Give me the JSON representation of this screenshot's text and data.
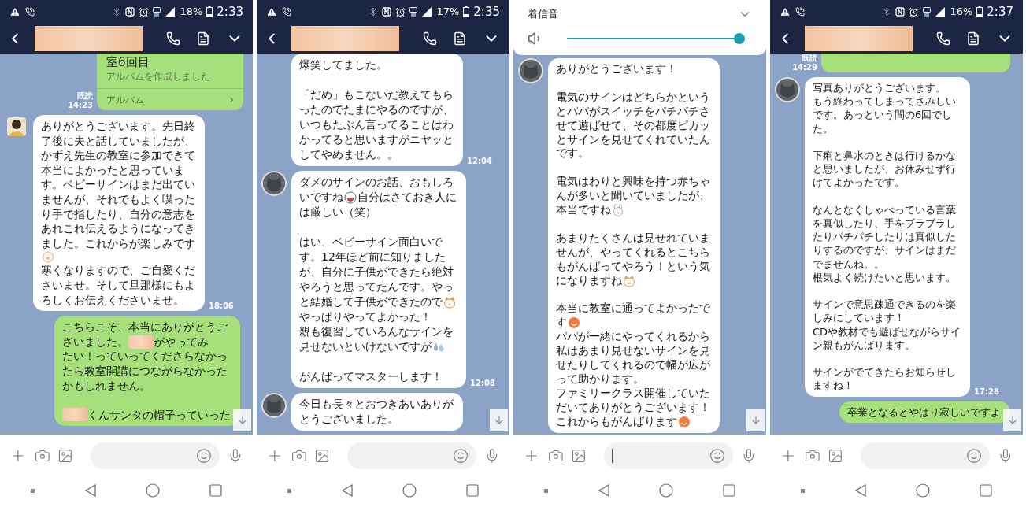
{
  "panels": [
    {
      "kind": "chat",
      "status_bar": {
        "battery": "18%",
        "time": "2:33"
      },
      "input": {
        "focused": false
      },
      "messages": [
        {
          "kind": "album",
          "outgoing": true,
          "title": "室6回目",
          "subtitle": "アルバムを作成しました",
          "link": "アルバム",
          "link_arrow": "›",
          "read": "既読",
          "time": "14:23"
        },
        {
          "kind": "text",
          "outgoing": false,
          "avatar": {
            "kind": "person"
          },
          "time": "18:06",
          "paragraphs": [
            [
              "ありがとうございます。先日終",
              "了後に夫と話していましたが、",
              "かずえ先生の教室に参加できて",
              "本当によかったと思っていま",
              "す。ベビーサインはまだ出てい",
              "ませんが、それでもよく喋った",
              "り手で指したり、自分の意志を",
              "あれこれ伝えるようになってき",
              "ました。これからが楽しみです",
              {
                "parts": [
                  {
                    "kind": "pig"
                  }
                ]
              },
              "寒くなりますので、ご自愛くだ",
              "さいませ。そして旦那様にもよ",
              "ろしくお伝えくださいませ。"
            ]
          ]
        },
        {
          "kind": "text",
          "outgoing": true,
          "paragraphs": [
            [
              "こちらこそ、本当にありがとうご",
              {
                "parts": [
                  {
                    "kind": "text",
                    "text": "ざいました。"
                  },
                  {
                    "kind": "redacted"
                  },
                  {
                    "kind": "text",
                    "text": "がやってみ"
                  }
                ]
              },
              "たい！っていってくださらなかっ",
              "たら教室開講につながらなかった",
              "かもしれません。"
            ],
            [
              {
                "parts": [
                  {
                    "kind": "redacted"
                  },
                  {
                    "kind": "text",
                    "text": "くんサンタの帽子っていった"
                  }
                ]
              }
            ]
          ]
        }
      ]
    },
    {
      "kind": "chat",
      "status_bar": {
        "battery": "17%",
        "time": "2:35"
      },
      "input": {
        "focused": false
      },
      "messages": [
        {
          "kind": "text",
          "outgoing": false,
          "time": "12:04",
          "paragraphs": [
            [
              "爆笑してました。"
            ],
            [
              "「だめ」もこないだ教えてもら",
              "ったのでたまにやるのですが、",
              "いつもたぶん言ってることはわ",
              "かってると思いますがニヤッと",
              "してやめません。。"
            ]
          ]
        },
        {
          "kind": "text",
          "outgoing": false,
          "avatar": {
            "kind": "cat"
          },
          "time": "12:08",
          "paragraphs": [
            [
              "ダメのサインのお話、おもしろ",
              {
                "parts": [
                  {
                    "kind": "text",
                    "text": "いですね"
                  },
                  {
                    "kind": "grin"
                  },
                  {
                    "kind": "text",
                    "text": "自分はさておき人に"
                  }
                ]
              },
              "は厳しい（笑）"
            ],
            [
              "はい、ベビーサイン面白いで",
              "す。12年ほど前に知りました",
              "が、自分に子供ができたら絶対",
              "やろうと思ってたんです。やっ",
              {
                "parts": [
                  {
                    "kind": "text",
                    "text": "と結婚して子供ができたので"
                  },
                  {
                    "kind": "raccoon"
                  }
                ]
              },
              "やっぱりやってよかった！",
              "親も復習していろんなサインを",
              {
                "parts": [
                  {
                    "kind": "text",
                    "text": "見せないといけないですが"
                  },
                  {
                    "kind": "drop"
                  }
                ]
              }
            ],
            [
              "がんばってマスターします！"
            ]
          ]
        },
        {
          "kind": "text",
          "outgoing": false,
          "avatar": {
            "kind": "cat"
          },
          "paragraphs": [
            [
              "今日も長々とおつきあいありが",
              "とうございました。"
            ]
          ]
        }
      ]
    },
    {
      "kind": "chat",
      "volume_popup": {
        "label": "着信音",
        "level": 1
      },
      "input": {
        "focused": true
      },
      "messages": [
        {
          "kind": "text",
          "outgoing": false,
          "avatar": {
            "kind": "cat"
          },
          "paragraphs": [
            [
              "ありがとうございます！"
            ],
            [
              "電気のサインはどちらかという",
              "とパパがスイッチをパチパチさ",
              "せて遊ばせて、その都度ピカッ",
              "とサインを見せてくれていたん",
              "です。"
            ],
            [
              "電気はわりと興味を持つ赤ちゃ",
              "んが多いと聞いていましたが、",
              {
                "parts": [
                  {
                    "kind": "text",
                    "text": "本当ですね"
                  },
                  {
                    "kind": "rabbit"
                  }
                ]
              }
            ],
            [
              "あまりたくさんは見せれていま",
              "せんが、やってくれるとこちら",
              "もがんばってやろう！という気",
              {
                "parts": [
                  {
                    "kind": "text",
                    "text": "になりますね"
                  },
                  {
                    "kind": "raccoon"
                  }
                ]
              }
            ],
            [
              "本当に教室に通ってよかったで",
              {
                "parts": [
                  {
                    "kind": "text",
                    "text": "す"
                  },
                  {
                    "kind": "smile"
                  }
                ]
              },
              "パパが一緒にやってくれるから",
              "私はあまり見せないサインを見",
              "せたりしてくれるので幅が広が",
              "って助かります。",
              "ファミリークラス開催していた",
              "だいてありがとうございます！",
              {
                "parts": [
                  {
                    "kind": "text",
                    "text": "これからもがんばります"
                  },
                  {
                    "kind": "smile"
                  }
                ]
              }
            ]
          ]
        }
      ]
    },
    {
      "kind": "chat",
      "status_bar": {
        "battery": "16%",
        "time": "2:37"
      },
      "input": {
        "focused": false
      },
      "messages": [
        {
          "kind": "stub",
          "outgoing": true,
          "read": "既読",
          "time": "14:29"
        },
        {
          "kind": "text",
          "outgoing": false,
          "avatar": {
            "kind": "cat"
          },
          "time": "17:28",
          "paragraphs": [
            [
              "写真ありがとうございます。",
              "もう終わってしまってさみしい",
              "です。あっという間の6回でし",
              "た。"
            ],
            [
              "下痢と鼻水のときは行けるかな",
              "と思いましたが、お休みせず行",
              "けてよかったです。"
            ],
            [
              "なんとなくしゃべっている言葉",
              "を真似したり、手をブラブラし",
              "たりパチパチしたりは真似した",
              "りするのですが、サインはまだ",
              "でませんね。。",
              "根気よく続けたいと思います。"
            ],
            [
              "サインで意思疎通できるのを楽",
              "しみにしています！",
              "CDや教材でも遊ばせながらサイ",
              "ン親もがんばります。"
            ],
            [
              "サインがでてきたらお知らせし",
              "ますね！"
            ]
          ]
        },
        {
          "kind": "text",
          "outgoing": true,
          "paragraphs": [
            [
              "卒業となるとやはり寂しいですよ"
            ]
          ]
        }
      ]
    }
  ]
}
